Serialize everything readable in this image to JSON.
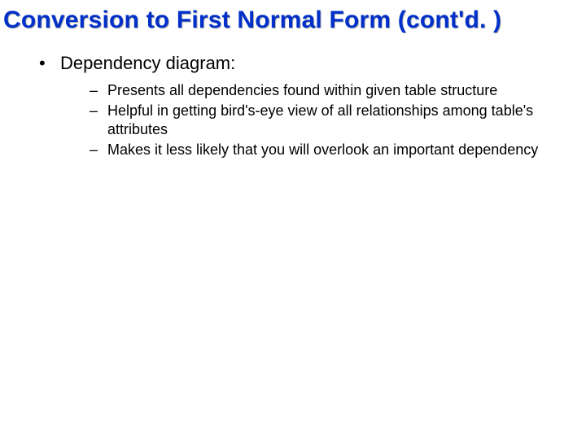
{
  "title": "Conversion to First Normal Form (cont'd. )",
  "bullets": [
    {
      "text": "Dependency diagram:",
      "sub": [
        "Presents all dependencies found within given table structure",
        "Helpful in getting bird's-eye view of all relationships among table's attributes",
        "Makes it less likely that you will overlook an important dependency"
      ]
    }
  ]
}
